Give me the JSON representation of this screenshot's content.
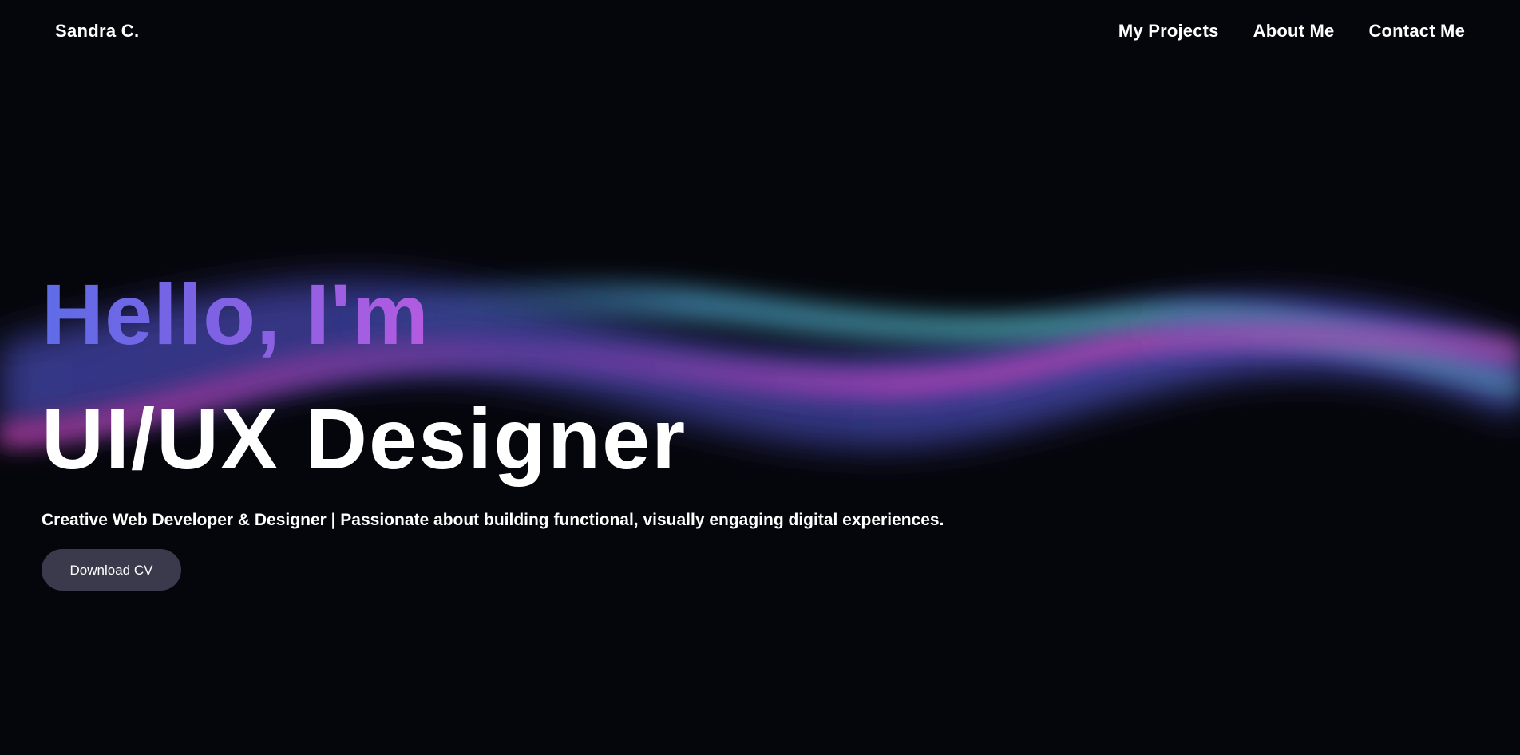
{
  "nav": {
    "brand": "Sandra C.",
    "links": [
      {
        "label": "My Projects"
      },
      {
        "label": "About Me"
      },
      {
        "label": "Contact Me"
      }
    ]
  },
  "hero": {
    "greeting": "Hello, I'm",
    "role": "UI/UX Designer",
    "tagline": "Creative Web Developer & Designer | Passionate about building functional, visually engaging digital experiences.",
    "cta_label": "Download CV"
  },
  "colors": {
    "background": "#05060b",
    "greeting_gradient_start": "#5f6ce8",
    "greeting_gradient_end": "#b45be0",
    "button_bg": "#3a3a4c",
    "wave_teal": "#3f8f95",
    "wave_magenta": "#b042b8",
    "wave_blue": "#3c3f9e"
  }
}
